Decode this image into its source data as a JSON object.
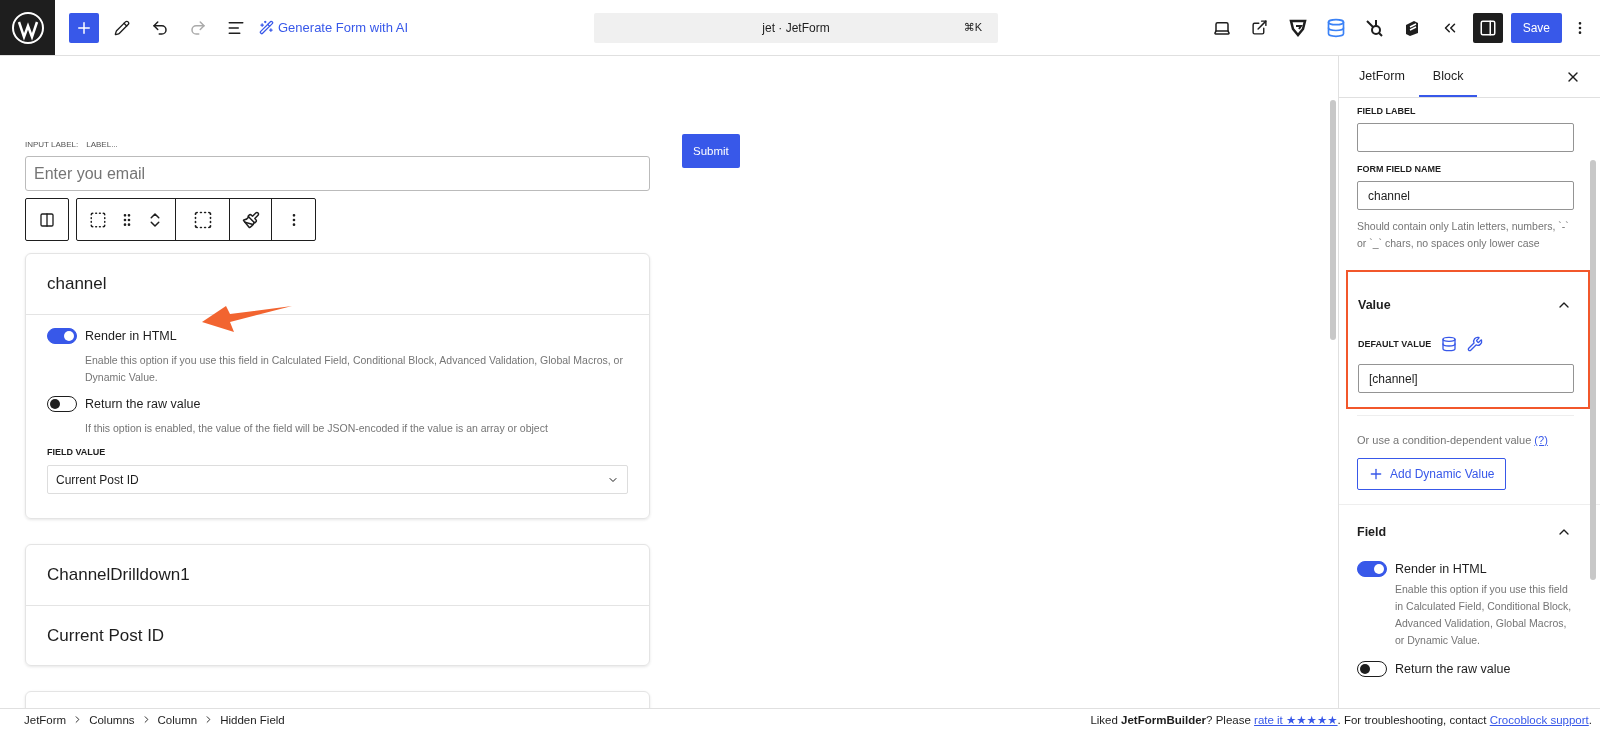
{
  "topbar": {
    "ai_button": "Generate Form with AI",
    "command": "jet · JetForm",
    "shortcut": "⌘K",
    "save": "Save"
  },
  "canvas": {
    "input": {
      "label_key": "INPUT LABEL:",
      "label_value": "LABEL...",
      "placeholder": "Enter you email"
    },
    "submit": "Submit",
    "hidden_field": {
      "title": "channel",
      "toggles": [
        {
          "label": "Render in HTML",
          "on": true,
          "help": "Enable this option if you use this field in Calculated Field, Conditional Block, Advanced Validation, Global Macros, or Dynamic Value."
        },
        {
          "label": "Return the raw value",
          "on": false,
          "help": "If this option is enabled, the value of the field will be JSON-encoded if the value is an array or object"
        }
      ],
      "field_value_label": "FIELD VALUE",
      "field_value": "Current Post ID"
    },
    "list_card": {
      "rows": [
        "ChannelDrilldown1",
        "Current Post ID"
      ]
    }
  },
  "sidebar": {
    "tabs": [
      {
        "label": "JetForm",
        "selected": false
      },
      {
        "label": "Block",
        "selected": true
      }
    ],
    "field_label": {
      "label": "FIELD LABEL"
    },
    "field_name": {
      "label": "FORM FIELD NAME",
      "value": "channel",
      "help": "Should contain only Latin letters, numbers, `-` or `_` chars, no spaces only lower case"
    },
    "value_section": {
      "title": "Value",
      "expanded": true,
      "highlighted": true,
      "default_label": "DEFAULT VALUE",
      "default_value": "[channel]"
    },
    "condition_text": "Or use a condition-dependent value",
    "condition_link": "(?)",
    "add_button": "Add Dynamic Value",
    "field_section": {
      "title": "Field",
      "expanded": true,
      "toggles": [
        {
          "label": "Render in HTML",
          "on": true,
          "help": "Enable this option if you use this field in Calculated Field, Conditional Block, Advanced Validation, Global Macros, or Dynamic Value."
        },
        {
          "label": "Return the raw value",
          "on": false
        }
      ]
    }
  },
  "breadcrumb": [
    "JetForm",
    "Columns",
    "Column",
    "Hidden Field"
  ],
  "footer": {
    "before": "Liked **JetFormBuilder**? Please",
    "rate_link": "rate it ★★★★★",
    "middle": ". For troubleshooting, contact",
    "support_link": "Crocoblock support",
    "end": "."
  }
}
